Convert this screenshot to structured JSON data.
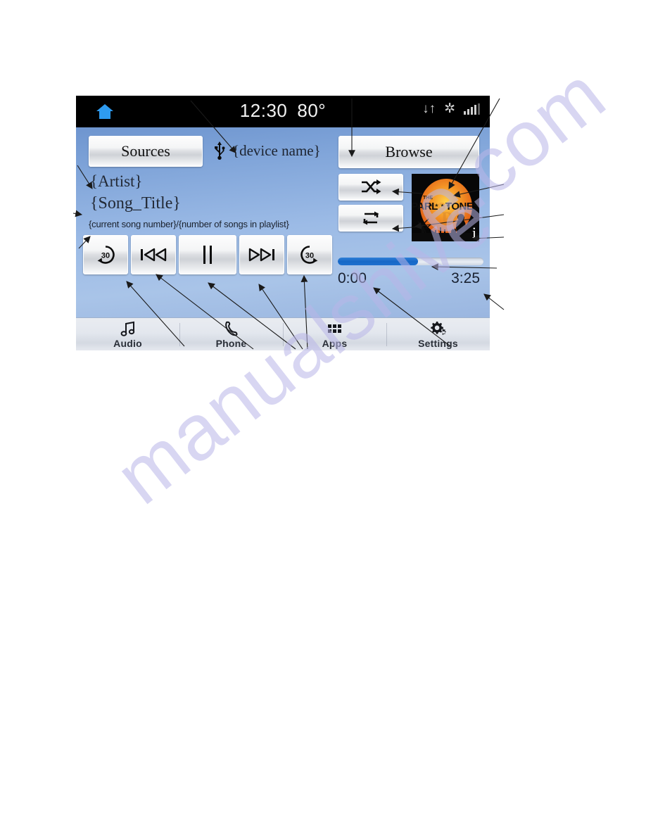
{
  "watermark": {
    "text_main": "manualshive",
    "text_secondary": "e.com"
  },
  "device_screen": {
    "status_bar": {
      "home_icon": "home-icon",
      "time": "12:30",
      "temperature": "80°",
      "icons": [
        {
          "name": "data-transfer-icon",
          "glyph": "↓↑"
        },
        {
          "name": "climate-snowflake-icon",
          "glyph": "✲"
        },
        {
          "name": "signal-bars-icon",
          "glyph": "signal"
        }
      ]
    },
    "header": {
      "sources_button": "Sources",
      "usb_icon": "usb-icon",
      "device_name": "{device name}",
      "browse_button": "Browse"
    },
    "now_playing": {
      "artist": "{Artist}",
      "song_title": "{Song_Title}",
      "song_count": "{current song number}/{number of songs in playlist}"
    },
    "transport_controls": [
      {
        "name": "rewind-30-button",
        "label": "30",
        "icon": "rewind-30-icon"
      },
      {
        "name": "previous-track-button",
        "label": "",
        "icon": "previous-track-icon"
      },
      {
        "name": "pause-button",
        "label": "",
        "icon": "pause-icon"
      },
      {
        "name": "next-track-button",
        "label": "",
        "icon": "next-track-icon"
      },
      {
        "name": "forward-30-button",
        "label": "30",
        "icon": "forward-30-icon"
      }
    ],
    "playback_modes": [
      {
        "name": "shuffle-button",
        "icon": "shuffle-icon"
      },
      {
        "name": "repeat-button",
        "icon": "repeat-icon"
      }
    ],
    "album_art": {
      "artist_text": "THE",
      "band_text": "PARLOTONES",
      "info_badge": "i"
    },
    "progress": {
      "elapsed": "0:00",
      "total": "3:25",
      "percent": 55,
      "fill_color": "#1668c6"
    },
    "nav_bar": [
      {
        "name": "nav-audio",
        "label": "Audio",
        "icon": "music-note-icon"
      },
      {
        "name": "nav-phone",
        "label": "Phone",
        "icon": "phone-handset-icon"
      },
      {
        "name": "nav-apps",
        "label": "Apps",
        "icon": "apps-grid-icon"
      },
      {
        "name": "nav-settings",
        "label": "Settings",
        "icon": "gear-icon"
      }
    ]
  },
  "colors": {
    "status_bar_bg": "#000000",
    "screen_blue": "#9cbbe6",
    "home_icon_blue": "#2e9bf0",
    "progress_blue": "#1668c6",
    "watermark": "#b9b6e8"
  }
}
